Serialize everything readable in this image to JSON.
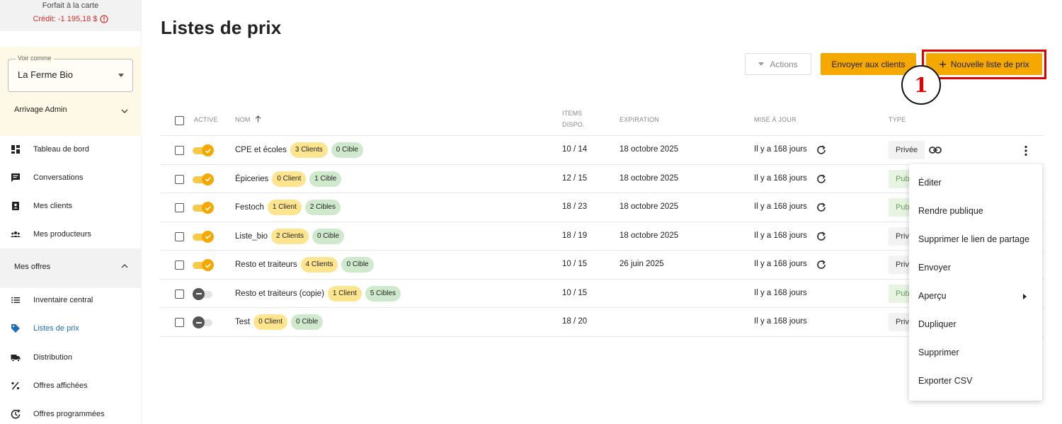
{
  "sidebar": {
    "plan_name": "Forfait à la carte",
    "credit": "Crédit: -1 195,18 $",
    "view_as_legend": "Voir comme",
    "view_as_value": "La Ferme Bio",
    "admin_label": "Arrivage Admin",
    "nav": [
      {
        "label": "Tableau de bord",
        "icon": "dashboard-icon"
      },
      {
        "label": "Conversations",
        "icon": "chat-icon"
      },
      {
        "label": "Mes clients",
        "icon": "contacts-icon"
      },
      {
        "label": "Mes producteurs",
        "icon": "group-icon"
      }
    ],
    "offers_section": "Mes offres",
    "offers_nav": [
      {
        "label": "Inventaire central",
        "icon": "list-icon"
      },
      {
        "label": "Listes de prix",
        "icon": "price-tag-icon",
        "active": true
      },
      {
        "label": "Distribution",
        "icon": "truck-icon"
      },
      {
        "label": "Offres affichées",
        "icon": "percent-tag-icon"
      },
      {
        "label": "Offres programmées",
        "icon": "scheduled-icon"
      }
    ]
  },
  "page": {
    "title": "Listes de prix",
    "actions_label": "Actions",
    "send_label": "Envoyer aux clients",
    "new_label": "Nouvelle liste de prix",
    "step_number": "1"
  },
  "table": {
    "headers": {
      "active": "Active",
      "name": "Nom",
      "items_line1": "Items",
      "items_line2": "Dispo.",
      "expiration": "Expiration",
      "updated": "Mise à jour",
      "type": "Type"
    },
    "rows": [
      {
        "active": true,
        "name": "CPE et écoles",
        "clients": "3 Clients",
        "cibles": "0 Cible",
        "items": "10 / 14",
        "expiration": "18 octobre 2025",
        "updated": "Il y a 168 jours",
        "refresh": true,
        "type": "Privée",
        "type_kind": "priv"
      },
      {
        "active": true,
        "name": "Épiceries",
        "clients": "0 Client",
        "cibles": "1 Cible",
        "items": "12 / 15",
        "expiration": "18 octobre 2025",
        "updated": "Il y a 168 jours",
        "refresh": true,
        "type": "Pub",
        "type_kind": "pub"
      },
      {
        "active": true,
        "name": "Festoch",
        "clients": "1 Client",
        "cibles": "2 Cibles",
        "items": "18 / 23",
        "expiration": "18 octobre 2025",
        "updated": "Il y a 168 jours",
        "refresh": true,
        "type": "Pub",
        "type_kind": "pub"
      },
      {
        "active": true,
        "name": "Liste_bio",
        "clients": "2 Clients",
        "cibles": "0 Cible",
        "items": "18 / 19",
        "expiration": "18 octobre 2025",
        "updated": "Il y a 168 jours",
        "refresh": true,
        "type": "Priv",
        "type_kind": "priv"
      },
      {
        "active": true,
        "name": "Resto et traiteurs",
        "clients": "4 Clients",
        "cibles": "0 Cible",
        "items": "10 / 15",
        "expiration": "26 juin 2025",
        "updated": "Il y a 168 jours",
        "refresh": true,
        "type": "Priv",
        "type_kind": "priv"
      },
      {
        "active": false,
        "name": "Resto et traiteurs (copie)",
        "clients": "1 Client",
        "cibles": "5 Cibles",
        "items": "10 / 15",
        "expiration": "",
        "updated": "Il y a 168 jours",
        "refresh": false,
        "type": "Pub",
        "type_kind": "pub"
      },
      {
        "active": false,
        "name": "Test",
        "clients": "0 Client",
        "cibles": "0 Cible",
        "items": "18 / 20",
        "expiration": "",
        "updated": "Il y a 168 jours",
        "refresh": false,
        "type": "Priv",
        "type_kind": "priv"
      }
    ]
  },
  "menu": {
    "items": [
      "Éditer",
      "Rendre publique",
      "Supprimer le lien de partage",
      "Envoyer",
      "Aperçu",
      "Dupliquer",
      "Supprimer",
      "Exporter CSV"
    ]
  },
  "colors": {
    "accent": "#f5a800",
    "active_link": "#1e6fb5",
    "highlight": "#e00000",
    "credit": "#d32f2f"
  }
}
